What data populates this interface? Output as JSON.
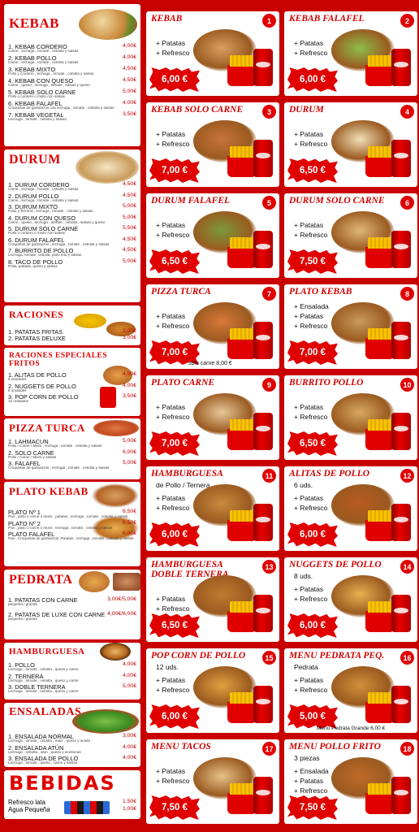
{
  "left": {
    "kebab": {
      "title": "KEBAB",
      "items": [
        {
          "name": "1. KEBAB CORDERO",
          "desc": "Carne , lechuga , tomate , cebolla y salsas",
          "price": "4,00€"
        },
        {
          "name": "2. KEBAB POLLO",
          "desc": "Carne , lechuga , tomate , cebolla y salsas",
          "price": "4,00€"
        },
        {
          "name": "3. KEBAB MIXTO",
          "desc": "Pollo y Cordero , lechuga , tomate , cebolla y salsas",
          "price": "4,50€"
        },
        {
          "name": "4. KEBAB CON QUESO",
          "desc": "Carne , queso , lechuga , tomate , salsas y queso",
          "price": "4,50€"
        },
        {
          "name": "5. KEBAB SOLO CARNE",
          "desc": "Pollo o cordero o mixto con salsas",
          "price": "5,00€"
        },
        {
          "name": "6. KEBAB FALAFEL",
          "desc": "Croquetas de garbanzos con lechuga , tomate , cebolla y salsas",
          "price": "4,00€"
        },
        {
          "name": "7. KEBAB VEGETAL",
          "desc": "Lechuga , tomate , cebolla y salsas",
          "price": "3,50€"
        }
      ]
    },
    "durum": {
      "title": "DURUM",
      "items": [
        {
          "name": "1. DURUM CORDERO",
          "desc": "Carne , lechuga , tomate , cebolla y salsas",
          "price": "4,50€"
        },
        {
          "name": "2. DURUM POLLO",
          "desc": "Carne , lechuga , tomate , cebolla y salsas",
          "price": "4,50€"
        },
        {
          "name": "3. DURUM MIXTO",
          "desc": "Pollo y Ternera , lechuga , tomate , cebolla y salsas",
          "price": "5,00€"
        },
        {
          "name": "4. DURUM CON QUESO",
          "desc": "Carne , queso , lechuga , tomate , cebolla , salsas y queso",
          "price": "5,00€"
        },
        {
          "name": "5. DURUM SOLO CARNE",
          "desc": "Pollo o cordero o mixto con salsas",
          "price": "5,50€"
        },
        {
          "name": "6. DURUM FALAFEL",
          "desc": "Croquetas de garbanzos , lechuga , tomate , cebolla y salsas",
          "price": "4,50€"
        },
        {
          "name": "7. BURRITO DE POLLO",
          "desc": "Lechuga, tomate, cebolla, pollo frito y salsas",
          "price": "4,50€"
        },
        {
          "name": "8. TACO DE POLLO",
          "desc": "Pollo, patatas, queso y salsas",
          "price": "5,00€"
        }
      ]
    },
    "raciones": {
      "title": "RACIONES",
      "items": [
        {
          "name": "1. PATATAS FRITAS",
          "price": "2,00€"
        },
        {
          "name": "2. PATATAS DELUXE",
          "price": "3,00€"
        }
      ]
    },
    "especiales": {
      "title": "RACIONES ESPECIALES FRITOS",
      "items": [
        {
          "name": "1. ALITAS DE POLLO",
          "desc": "6 unidades",
          "price": "4,00€"
        },
        {
          "name": "2. NUGGETS DE POLLO",
          "desc": "8 unidades",
          "price": "4,00€"
        },
        {
          "name": "3. POP CORN DE POLLO",
          "desc": "12 unidades",
          "price": "3,50€"
        }
      ]
    },
    "pizza": {
      "title": "PIZZA TURCA",
      "items": [
        {
          "name": "1. LAHMACUN",
          "desc": "Pollo / Carne / Mixto , lechuga , tomate , cebolla y salsas",
          "price": "5,00€"
        },
        {
          "name": "2. SOLO CARNE",
          "desc": "Pollo / Carne / Mixto y salsas",
          "price": "6,00€"
        },
        {
          "name": "3. FALAFEL",
          "desc": "Croquetas de garbanzos , lechuga , tomate , cebolla y salsas",
          "price": "5,00€"
        }
      ]
    },
    "plato": {
      "title": "PLATO KEBAB",
      "items": [
        {
          "name": "PLATO Nº 1",
          "desc": "Pan , pollo o carne o mixto , patatas , lechuga , tomate , cebolla y salsas",
          "price": "6,50€"
        },
        {
          "name": "PLATO Nº 2",
          "desc": "Pan , pollo o carne o mixto , lechuga , tomate , cebolla y salsas",
          "price": "6,50€"
        },
        {
          "name": "PLATO FALAFEL",
          "desc": "Pan , Croquetas de garbanzos ,Patatas , lechuga , tomate , cebolla y salsas",
          "price": "6,00€"
        }
      ]
    },
    "pedrata": {
      "title": "PEDRATA",
      "items": [
        {
          "name": "1. PATATAS CON CARNE",
          "desc": "pequeña / grande",
          "price": "3,00€/5,00€"
        },
        {
          "name": "2. PATATAS DE LUXE CON CARNE",
          "desc": "pequeña / grande",
          "price": "4,00€/6,00€"
        }
      ]
    },
    "hamburguesa": {
      "title": "HAMBURGUESA",
      "items": [
        {
          "name": "1. POLLO",
          "desc": "Lechuga , tomate , cebolla , queso y carne",
          "price": "4,00€"
        },
        {
          "name": "2. TERNERA",
          "desc": "Lechuga , tomate , cebolla , queso y carne",
          "price": "4,00€"
        },
        {
          "name": "3. DOBLE TERNERA",
          "desc": "Lechuga , tomate , cebolla , queso y carne",
          "price": "5,00€"
        }
      ]
    },
    "ensaladas": {
      "title": "ENSALADAS",
      "items": [
        {
          "name": "1. ENSALADA NORMAL",
          "desc": "Lechuga , tomate , cebolla , maíz , queso y aceite",
          "price": "3,00€"
        },
        {
          "name": "2. ENSALADA ATÚN",
          "desc": "Lechuga , cebolla , atún , queso y aceitunas",
          "price": "4,00€"
        },
        {
          "name": "3. ENSALADA DE POLLO",
          "desc": "Lechuga , tomate , queso , carne y salsas",
          "price": "4,00€"
        }
      ]
    },
    "bebidas": {
      "title": "BEBIDAS",
      "items": [
        {
          "name": "Refresco lata",
          "price": "1,50€"
        },
        {
          "name": "Agua Pequeña",
          "price": "1,00€"
        }
      ]
    }
  },
  "combos": [
    {
      "num": "1",
      "title": "KEBAB",
      "price": "6,00 €",
      "includes": [
        "+ Patatas",
        "+ Refresco"
      ]
    },
    {
      "num": "2",
      "title": "KEBAB FALAFEL",
      "price": "6,00 €",
      "includes": [
        "+ Patatas",
        "+ Refresco"
      ]
    },
    {
      "num": "3",
      "title": "KEBAB SOLO CARNE",
      "price": "7,00 €",
      "includes": [
        "+ Patatas",
        "+ Refresco"
      ]
    },
    {
      "num": "4",
      "title": "DURUM",
      "price": "6,50 €",
      "includes": [
        "+ Patatas",
        "+ Refresco"
      ]
    },
    {
      "num": "5",
      "title": "DURUM FALAFEL",
      "price": "6,50 €",
      "includes": [
        "+ Patatas",
        "+ Refresco"
      ]
    },
    {
      "num": "6",
      "title": "DURUM SOLO CARNE",
      "price": "7,50 €",
      "includes": [
        "+ Patatas",
        "+ Refresco"
      ]
    },
    {
      "num": "7",
      "title": "PIZZA TURCA",
      "price": "7,00 €",
      "includes": [
        "+ Patatas",
        "+ Refresco"
      ],
      "note": "sólo carne 8,00 €"
    },
    {
      "num": "8",
      "title": "PLATO KEBAB",
      "price": "7,00 €",
      "includes": [
        "+ Ensalada",
        "+ Patatas",
        "+ Refresco"
      ]
    },
    {
      "num": "9",
      "title": "PLATO CARNE",
      "price": "7,00 €",
      "includes": [
        "+ Patatas",
        "+ Refresco"
      ]
    },
    {
      "num": "10",
      "title": "BURRITO POLLO",
      "price": "6,50 €",
      "includes": [
        "+ Patatas",
        "+ Refresco"
      ]
    },
    {
      "num": "11",
      "title": "HAMBURGUESA",
      "sub": "de Pollo / Ternera",
      "price": "6,00 €",
      "includes": [
        "+ Patatas",
        "+ Refresco"
      ]
    },
    {
      "num": "12",
      "title": "ALITAS DE POLLO",
      "sub": "6 uds.",
      "price": "6,00 €",
      "includes": [
        "+ Patatas",
        "+ Refresco"
      ]
    },
    {
      "num": "13",
      "title": "HAMBURGUESA DOBLE TERNERA",
      "price": "6,50 €",
      "includes": [
        "+ Patatas",
        "+ Refresco"
      ]
    },
    {
      "num": "14",
      "title": "NUGGETS DE POLLO",
      "sub": "8 uds.",
      "price": "6,00 €",
      "includes": [
        "+ Patatas",
        "+ Refresco"
      ]
    },
    {
      "num": "15",
      "title": "POP CORN DE POLLO",
      "sub": "12 uds.",
      "price": "6,00 €",
      "includes": [
        "+ Patatas",
        "+ Refresco"
      ]
    },
    {
      "num": "16",
      "title": "MENU PEDRATA PEQ.",
      "sub": "Pedrata",
      "price": "5,00 €",
      "includes": [
        "+ Patatas",
        "+ Refresco"
      ],
      "note": "Menú Pedrata Grande 6,00 €"
    },
    {
      "num": "17",
      "title": "MENU TACOS",
      "price": "7,50 €",
      "includes": [
        "+ Patatas",
        "+ Refresco"
      ]
    },
    {
      "num": "18",
      "title": "MENU POLLO FRITO",
      "sub": "3 piezas",
      "price": "7,50 €",
      "includes": [
        "+ Ensalada",
        "+ Patatas",
        "+ Refresco"
      ]
    }
  ]
}
